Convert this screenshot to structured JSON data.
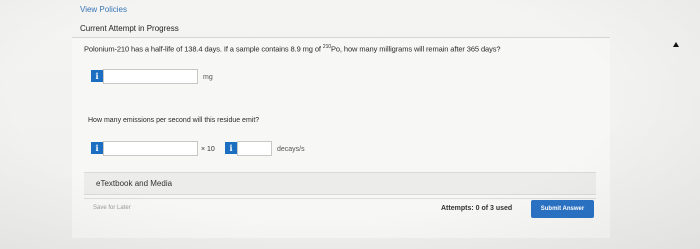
{
  "header": {
    "view_policies": "View Policies",
    "attempt_status": "Current Attempt in Progress"
  },
  "question": {
    "text_before": "Polonium-210 has a half-life of 138.4 days. If a sample contains 8.9 mg of ",
    "isotope_mass_number": "210",
    "text_after": "Po, how many milligrams will remain after 365 days?",
    "info_icon": "i",
    "answer1_value": "",
    "answer1_unit": "mg",
    "sub_question": "How many emissions per second will this residue emit?",
    "multiplier": "× 10",
    "answer2_value": "",
    "exponent_value": "",
    "answer2_unit": "decays/s"
  },
  "resources": {
    "etextbook": "eTextbook and Media"
  },
  "footer": {
    "save_later": "Save for Later",
    "attempts": "Attempts: 0 of 3 used",
    "submit": "Submit Answer"
  },
  "colors": {
    "accent": "#1c6fc0",
    "link": "#3a76b8",
    "submit_bg": "#2a72c4"
  }
}
